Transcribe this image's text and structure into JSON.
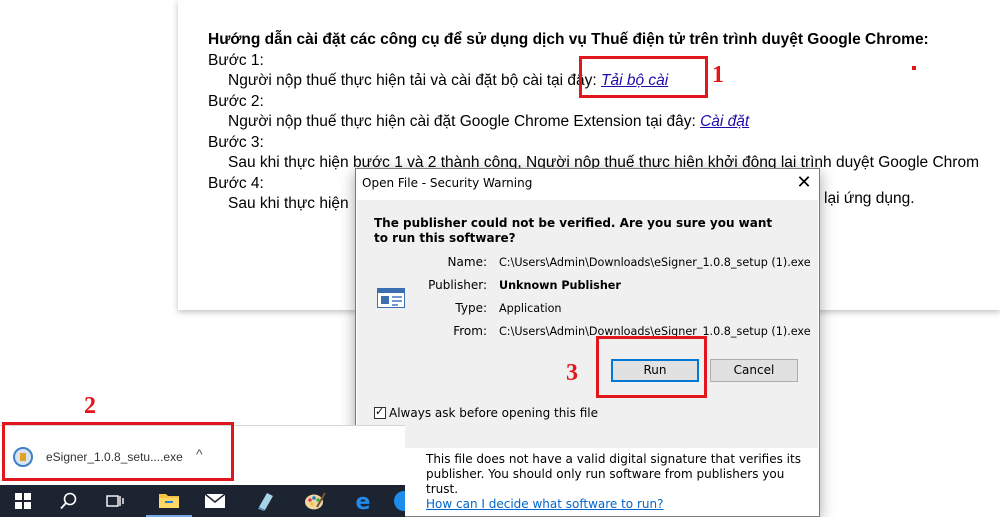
{
  "page": {
    "heading": "Hướng dẫn cài đặt các công cụ để sử dụng dịch vụ Thuế điện tử trên trình duyệt Google Chrome:",
    "steps": [
      {
        "label": "Bước 1:",
        "text": "Người nộp thuế thực hiện tải và cài đặt bộ cài tại đây: ",
        "link": "Tải bộ cài"
      },
      {
        "label": "Bước 2:",
        "text": "Người nộp thuế thực hiện cài đặt Google Chrome Extension tại đây: ",
        "link": "Cài đặt"
      },
      {
        "label": "Bước 3:",
        "text": "Sau khi thực hiện bước 1 và 2 thành công, Người nộp thuế thực hiện khởi động lại trình duyệt Google Chrom"
      },
      {
        "label": "Bước 4:",
        "text": "Sau khi thực hiện",
        "tail": "lại ứng dụng."
      }
    ]
  },
  "annotations": {
    "n1": "1",
    "n2": "2",
    "n3": "3",
    "color": "#e0171c"
  },
  "dialog": {
    "title": "Open File - Security Warning",
    "close": "✕",
    "question": "The publisher could not be verified.  Are you sure you want to run this software?",
    "fields": [
      {
        "label": "Name:",
        "value": "C:\\Users\\Admin\\Downloads\\eSigner_1.0.8_setup (1).exe"
      },
      {
        "label": "Publisher:",
        "value": "Unknown Publisher"
      },
      {
        "label": "Type:",
        "value": "Application"
      },
      {
        "label": "From:",
        "value": "C:\\Users\\Admin\\Downloads\\eSigner_1.0.8_setup (1).exe"
      }
    ],
    "run_label": "Run",
    "cancel_label": "Cancel",
    "checkbox_label": "Always ask before opening this file",
    "checkbox_checked": true,
    "note": "This file does not have a valid digital signature that verifies its publisher.  You should only run software from publishers you trust.",
    "help_link": "How can I decide what software to run?"
  },
  "download": {
    "filename": "eSigner_1.0.8_setu....exe",
    "chevron": "^"
  },
  "taskbar": {
    "icons": [
      "windows-start-icon",
      "search-icon",
      "task-view-icon",
      "file-explorer-icon",
      "mail-icon",
      "notepad-icon",
      "paint-icon",
      "edge-icon",
      "chrome-icon"
    ],
    "background": "#1c2331"
  }
}
